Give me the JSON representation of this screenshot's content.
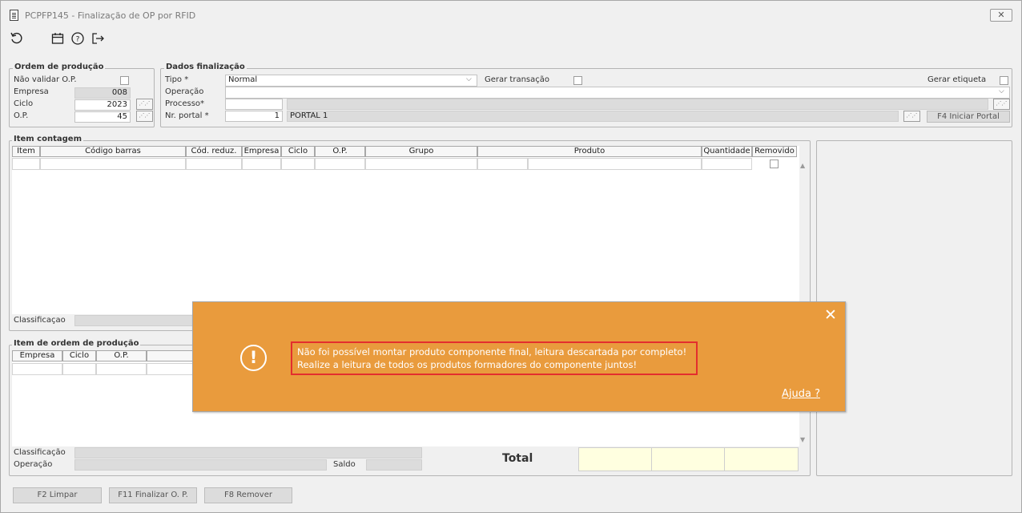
{
  "window": {
    "title": "PCPFP145 - Finalização de OP por RFID",
    "close_label": "✕"
  },
  "toolbar": {
    "icons": [
      "refresh-icon",
      "calendar-icon",
      "help-icon",
      "exit-icon"
    ]
  },
  "ordem": {
    "legend": "Ordem de produção",
    "nao_validar_label": "Não validar O.P.",
    "empresa_label": "Empresa",
    "empresa_value": "008",
    "ciclo_label": "Ciclo",
    "ciclo_value": "2023",
    "op_label": "O.P.",
    "op_value": "45"
  },
  "dados": {
    "legend": "Dados finalização",
    "tipo_label": "Tipo *",
    "tipo_value": "Normal",
    "gerar_transacao_label": "Gerar transação",
    "gerar_etiqueta_label": "Gerar etiqueta",
    "operacao_label": "Operação",
    "operacao_value": "",
    "processo_label": "Processo*",
    "processo_value": "",
    "nr_portal_label": "Nr. portal *",
    "nr_portal_value": "1",
    "portal_name": "PORTAL 1",
    "iniciar_portal_label": "F4 Iniciar Portal"
  },
  "item_contagem": {
    "legend": "Item contagem",
    "columns": [
      "Item",
      "Código barras",
      "Cód. reduz.",
      "Empresa",
      "Ciclo",
      "O.P.",
      "Grupo",
      "Produto",
      "Quantidade",
      "Removido"
    ],
    "classificacao_label": "Classificaçao"
  },
  "item_ordem": {
    "legend": "Item de ordem de produção",
    "columns": [
      "Empresa",
      "Ciclo",
      "O.P."
    ],
    "classificacao_label": "Classificação",
    "operacao_label": "Operação",
    "saldo_label": "Saldo",
    "total_label": "Total"
  },
  "buttons": {
    "limpar": "F2 Limpar",
    "finalizar": "F11 Finalizar O. P.",
    "remover": "F8 Remover"
  },
  "dialog": {
    "message_line1": "Não foi possível montar produto componente final, leitura descartada por completo!",
    "message_line2": "Realize a leitura de todos os produtos formadores do componente juntos!",
    "help_label": "Ajuda ?",
    "close_label": "✕",
    "icon_glyph": "!",
    "bg_color": "#e99b3d",
    "highlight_color": "#e32e2e"
  },
  "colors": {
    "total_cell_bg": "#ffffe0",
    "readonly_bg": "#dcdcdc"
  }
}
